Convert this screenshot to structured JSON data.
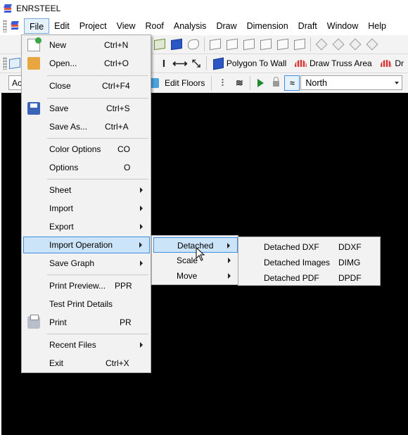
{
  "app": {
    "title": "ENRSTEEL"
  },
  "menubar": {
    "items": [
      "File",
      "Edit",
      "Project",
      "View",
      "Roof",
      "Analysis",
      "Draw",
      "Dimension",
      "Draft",
      "Window",
      "Help"
    ]
  },
  "toolbar2": {
    "polygon_to_wall": "Polygon To Wall",
    "draw_truss_area": "Draw Truss Area",
    "draw_truncated": "Dr"
  },
  "toolbar3": {
    "left_combo_value": "Ac",
    "edit_floors": "Edit Floors",
    "direction_value": "North"
  },
  "file_menu": {
    "items": [
      {
        "label": "New",
        "shortcut": "Ctrl+N"
      },
      {
        "label": "Open...",
        "shortcut": "Ctrl+O"
      },
      {
        "label": "Close",
        "shortcut": "Ctrl+F4"
      },
      {
        "label": "Save",
        "shortcut": "Ctrl+S"
      },
      {
        "label": "Save As...",
        "shortcut": "Ctrl+A"
      },
      {
        "label": "Color Options",
        "shortcut": "CO"
      },
      {
        "label": "Options",
        "shortcut": "O"
      },
      {
        "label": "Sheet",
        "shortcut": ""
      },
      {
        "label": "Import",
        "shortcut": ""
      },
      {
        "label": "Export",
        "shortcut": ""
      },
      {
        "label": "Import Operation",
        "shortcut": ""
      },
      {
        "label": "Save Graph",
        "shortcut": ""
      },
      {
        "label": "Print Preview...",
        "shortcut": "PPR"
      },
      {
        "label": "Test Print Details",
        "shortcut": ""
      },
      {
        "label": "Print",
        "shortcut": "PR"
      },
      {
        "label": "Recent Files",
        "shortcut": ""
      },
      {
        "label": "Exit",
        "shortcut": "Ctrl+X"
      }
    ]
  },
  "import_operation_menu": {
    "items": [
      "Detached",
      "Scale",
      "Move"
    ]
  },
  "detached_menu": {
    "items": [
      {
        "label": "Detached DXF",
        "shortcut": "DDXF"
      },
      {
        "label": "Detached Images",
        "shortcut": "DIMG"
      },
      {
        "label": "Detached PDF",
        "shortcut": "DPDF"
      }
    ]
  }
}
